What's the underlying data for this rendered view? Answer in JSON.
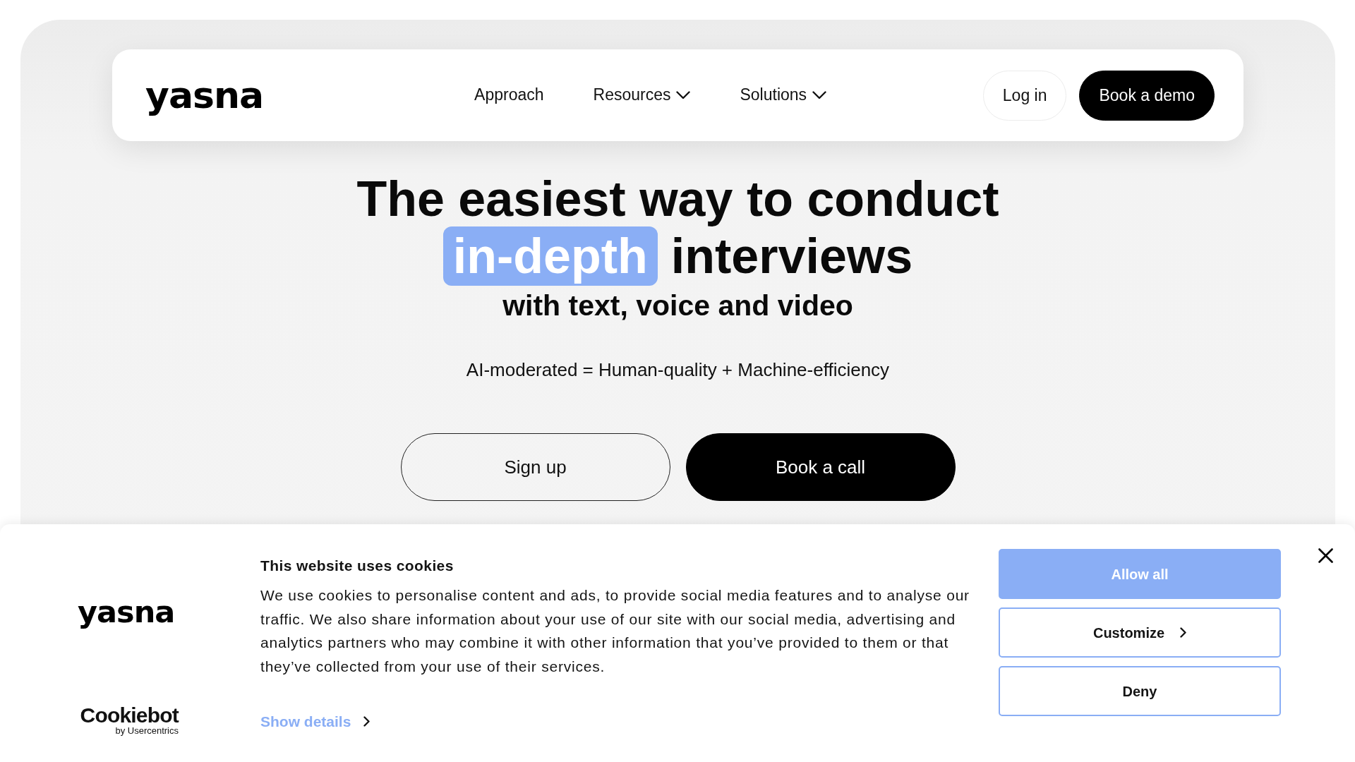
{
  "navbar": {
    "logo": "yasna",
    "links": [
      {
        "label": "Approach",
        "dropdown": false
      },
      {
        "label": "Resources",
        "dropdown": true
      },
      {
        "label": "Solutions",
        "dropdown": true
      }
    ],
    "buttons": [
      {
        "label": "Log in",
        "kind": "outline"
      },
      {
        "label": "Book a demo",
        "kind": "solid"
      }
    ]
  },
  "hero": {
    "headline": [
      {
        "text": "The easiest way to conduct",
        "highlighted": false
      },
      {
        "text": "in-depth",
        "highlighted": true
      },
      {
        "text": "interviews",
        "highlighted": false
      }
    ],
    "subheadline": "with text, voice and video",
    "tagline": "AI-moderated = Human-quality + Machine-efficiency",
    "buttons": [
      {
        "label": "Sign up",
        "kind": "outline"
      },
      {
        "label": "Book a call",
        "kind": "solid"
      }
    ]
  },
  "cookie_banner": {
    "logo": "yasna",
    "provider_logo": {
      "name": "Cookiebot",
      "byline": "by Usercentrics"
    },
    "title": "This website uses cookies",
    "body": "We use cookies to personalise content and ads, to provide social media features and to analyse our traffic. We also share information about your use of our site with our social media, advertising and analytics partners who may combine it with other information that you’ve provided to them or that they’ve collected from your use of their services.",
    "details_link": "Show details",
    "buttons": [
      {
        "label": "Allow all",
        "kind": "primary",
        "chevron": false
      },
      {
        "label": "Customize",
        "kind": "outline",
        "chevron": true
      },
      {
        "label": "Deny",
        "kind": "outline",
        "chevron": false
      }
    ]
  }
}
